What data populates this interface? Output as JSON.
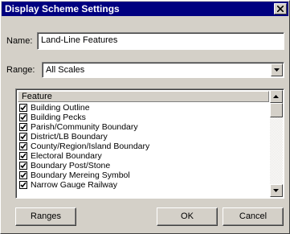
{
  "window": {
    "title": "Display Scheme Settings"
  },
  "name_field": {
    "label": "Name:",
    "value": "Land-Line Features"
  },
  "range_field": {
    "label": "Range:",
    "value": "All Scales"
  },
  "feature_list": {
    "header": "Feature",
    "items": [
      {
        "label": "Building Outline",
        "checked": true
      },
      {
        "label": "Building Pecks",
        "checked": true
      },
      {
        "label": "Parish/Community Boundary",
        "checked": true
      },
      {
        "label": "District/LB Boundary",
        "checked": true
      },
      {
        "label": "County/Region/Island Boundary",
        "checked": true
      },
      {
        "label": "Electoral Boundary",
        "checked": true
      },
      {
        "label": "Boundary Post/Stone",
        "checked": true
      },
      {
        "label": "Boundary Mereing Symbol",
        "checked": true
      },
      {
        "label": "Narrow Gauge Railway",
        "checked": true
      }
    ]
  },
  "buttons": {
    "ranges": "Ranges",
    "ok": "OK",
    "cancel": "Cancel"
  }
}
